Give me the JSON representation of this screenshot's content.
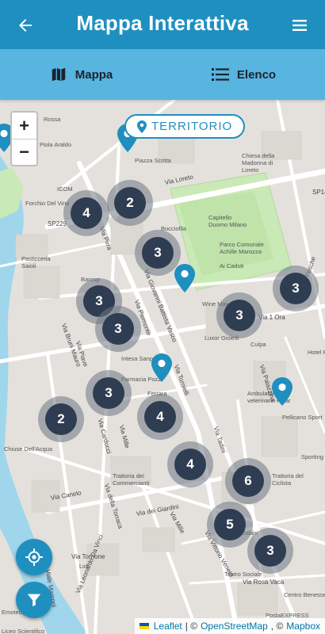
{
  "header": {
    "title": "Mappa Interattiva"
  },
  "tabs": [
    {
      "label": "Mappa"
    },
    {
      "label": "Elenco"
    }
  ],
  "map": {
    "zoom_in": "+",
    "zoom_out": "−",
    "territorio_label": "TERRITORIO",
    "clusters": [
      "4",
      "2",
      "3",
      "3",
      "3",
      "3",
      "3",
      "3",
      "2",
      "4",
      "4",
      "6",
      "5",
      "3"
    ],
    "place_labels": [
      "Piazza Scritta",
      "Chiesa della Madonna di Loreto",
      "ICOM",
      "Forchio Del Vino",
      "Capitello Duomo Milano",
      "Parco Comunale Achille Marozza",
      "Ai Caduti",
      "Bocciofila",
      "Pasticceria Saioli",
      "Barcup",
      "Wine Max",
      "Luxor Gioielli",
      "Intesa Sanpaolo",
      "Farmacia Pozzi",
      "Ferrara",
      "Culpa",
      "Ambulatorio veterinario Polar",
      "Pellicano Sport",
      "Chiuse Dell'Acqua",
      "Trattoria dei Commercianti",
      "Trattoria del Ciclista",
      "Dell Ercolani",
      "Teatro Sociale",
      "Lidl",
      "Centro Benessere",
      "PostaEXPRESS",
      "Hotel Ri",
      "Sporting",
      "Piola Araldo",
      "Rossa",
      "Emoteca Scout",
      "Liceo Scientifico"
    ],
    "street_labels": [
      "Via Loreto",
      "SP229",
      "SP14",
      "Via Pirra",
      "Via Giovanni Battista Vasco",
      "Via Piemonte",
      "Via Tornielli",
      "Via Bruni Mauro",
      "Via Piave",
      "Via Carducci",
      "Via Mille",
      "Via Canelo",
      "Via della Torraca",
      "Via dei Giardini",
      "Via Palazzina",
      "Via Tadini",
      "Via Torrione",
      "Via Leonardo Da Vinci",
      "Viale Marconi",
      "Via Mille",
      "Via Lige Fosche",
      "Via 1 Ora",
      "Via Rosa Vaca",
      "Via Vittorio Veneto"
    ],
    "attribution": {
      "leaflet": "Leaflet",
      "sep1": "| ©",
      "osm": "OpenStreetMap",
      "sep2": ", ©",
      "mapbox": "Mapbox"
    }
  },
  "colors": {
    "primary": "#1f8fbf",
    "tab_bar": "#57b5df",
    "cluster_core": "#2f3d52",
    "pin": "#1f8fbf",
    "park": "#c7e8b4",
    "water": "#9fd6ec"
  },
  "icons": {
    "back": "arrow-left-icon",
    "menu": "hamburger-menu-icon",
    "map_tab": "folded-map-icon",
    "list_tab": "list-icon",
    "territorio": "location-pin-icon",
    "locate": "crosshair-locate-icon",
    "filter": "funnel-filter-icon"
  }
}
